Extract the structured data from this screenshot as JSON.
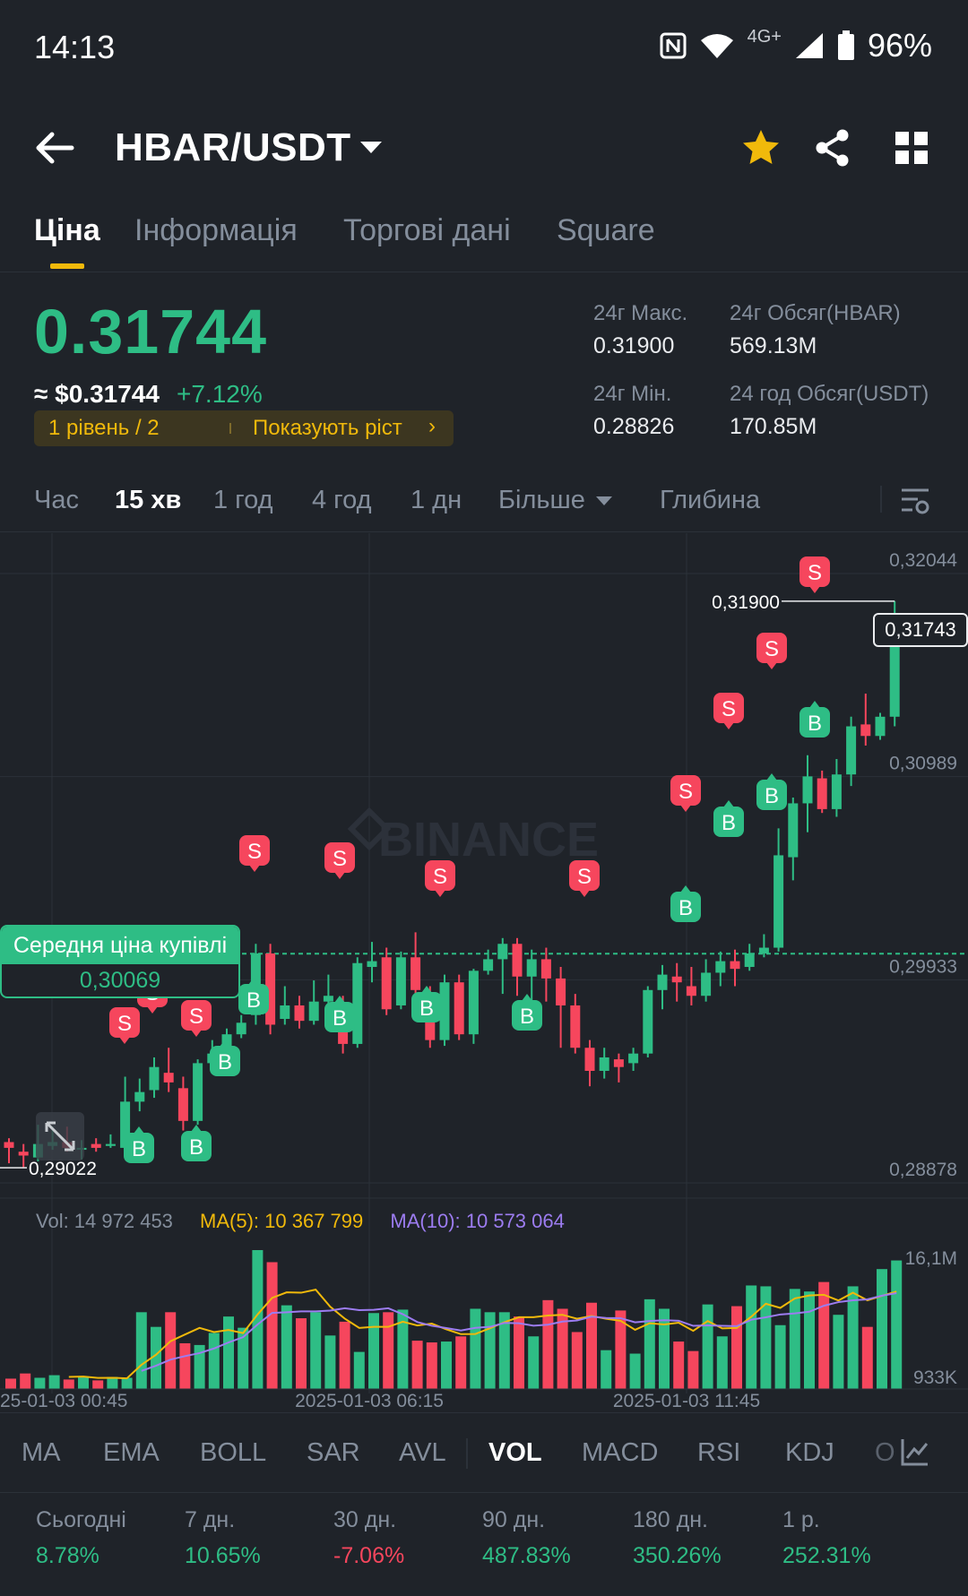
{
  "status": {
    "time": "14:13",
    "network": "4G+",
    "battery": "96%"
  },
  "header": {
    "pair": "HBAR/USDT"
  },
  "tabs": [
    {
      "label": "Ціна"
    },
    {
      "label": "Інформація"
    },
    {
      "label": "Торгові дані"
    },
    {
      "label": "Square"
    }
  ],
  "price": {
    "last": "0.31744",
    "usd": "≈ $0.31744",
    "change": "+7.12%",
    "level_left": "1 рівень / 2",
    "level_right": "Показують ріст"
  },
  "stats": {
    "high_label": "24г Макс.",
    "high": "0.31900",
    "vol_base_label": "24г Обсяг(HBAR)",
    "vol_base": "569.13M",
    "low_label": "24г Мін.",
    "low": "0.28826",
    "vol_quote_label": "24 год Обсяг(USDT)",
    "vol_quote": "170.85M"
  },
  "timeframes": {
    "time": "Час",
    "m15": "15 хв",
    "h1": "1 год",
    "h4": "4 год",
    "d1": "1 дн",
    "more": "Більше",
    "depth": "Глибина"
  },
  "chart_labels": {
    "axis": [
      "0,32044",
      "0,30989",
      "0,29933",
      "0,28878"
    ],
    "high_marker": "0,31900",
    "low_marker": "0,29022",
    "current": "0,31743",
    "avg_title": "Середня ціна купівлі",
    "avg_value": "0,30069",
    "watermark": "BINANCE",
    "vol_axis_top": "16,1M",
    "vol_axis_bottom": "933K",
    "dates": [
      "25-01-03 00:45",
      "2025-01-03 06:15",
      "2025-01-03 11:45"
    ],
    "sell": "S",
    "buy": "B"
  },
  "vol_info": {
    "vol": "Vol: 14 972 453",
    "ma5": "MA(5): 10 367 799",
    "ma10": "MA(10): 10 573 064"
  },
  "indicators": [
    "MA",
    "EMA",
    "BOLL",
    "SAR",
    "AVL",
    "VOL",
    "MACD",
    "RSI",
    "KDJ",
    "O"
  ],
  "performance": [
    {
      "label": "Сьогодні",
      "value": "8.78%"
    },
    {
      "label": "7 дн.",
      "value": "10.65%"
    },
    {
      "label": "30 дн.",
      "value": "-7.06%"
    },
    {
      "label": "90 дн.",
      "value": "487.83%"
    },
    {
      "label": "180 дн.",
      "value": "350.26%"
    },
    {
      "label": "1 р.",
      "value": "252.31%"
    }
  ],
  "colors": {
    "up": "#2ebd85",
    "down": "#f6465d",
    "accent": "#f0b90b",
    "ma5": "#f0b90b",
    "ma10": "#9c7cf0"
  },
  "chart_data": {
    "type": "candlestick",
    "interval": "15m",
    "y_axis_ticks": [
      0.32044,
      0.30989,
      0.29933,
      0.28878
    ],
    "high_24h": 0.319,
    "low_visible": 0.29022,
    "last": 0.31743,
    "avg_buy": 0.30069,
    "candles": [
      [
        0.2906,
        0.2909,
        0.2911,
        0.2898,
        "down"
      ],
      [
        0.2904,
        0.2902,
        0.2908,
        0.2896,
        "down"
      ],
      [
        0.2901,
        0.2908,
        0.2918,
        0.2899,
        "up"
      ],
      [
        0.2907,
        0.2909,
        0.2917,
        0.2905,
        "up"
      ],
      [
        0.2909,
        0.2906,
        0.2917,
        0.2904,
        "down"
      ],
      [
        0.2905,
        0.2906,
        0.291,
        0.29,
        "up"
      ],
      [
        0.2906,
        0.2908,
        0.2911,
        0.2904,
        "down"
      ],
      [
        0.2907,
        0.2908,
        0.2913,
        0.2906,
        "up"
      ],
      [
        0.2906,
        0.293,
        0.2943,
        0.2905,
        "up"
      ],
      [
        0.293,
        0.2935,
        0.2942,
        0.2925,
        "up"
      ],
      [
        0.2936,
        0.2948,
        0.2953,
        0.2932,
        "up"
      ],
      [
        0.2945,
        0.294,
        0.2958,
        0.2935,
        "down"
      ],
      [
        0.2937,
        0.292,
        0.2943,
        0.2915,
        "down"
      ],
      [
        0.292,
        0.295,
        0.2952,
        0.2918,
        "up"
      ],
      [
        0.295,
        0.2955,
        0.2962,
        0.2945,
        "up"
      ],
      [
        0.2955,
        0.2965,
        0.2968,
        0.2952,
        "up"
      ],
      [
        0.2965,
        0.2971,
        0.2975,
        0.2963,
        "up"
      ],
      [
        0.2975,
        0.3007,
        0.3012,
        0.297,
        "up"
      ],
      [
        0.3007,
        0.297,
        0.3012,
        0.2965,
        "down"
      ],
      [
        0.2973,
        0.298,
        0.299,
        0.297,
        "up"
      ],
      [
        0.298,
        0.2972,
        0.2985,
        0.2968,
        "down"
      ],
      [
        0.2972,
        0.2982,
        0.2993,
        0.297,
        "up"
      ],
      [
        0.2982,
        0.2985,
        0.2996,
        0.2978,
        "up"
      ],
      [
        0.298,
        0.296,
        0.2985,
        0.2955,
        "down"
      ],
      [
        0.296,
        0.3002,
        0.3005,
        0.2958,
        "up"
      ],
      [
        0.3,
        0.3003,
        0.3013,
        0.2992,
        "up"
      ],
      [
        0.3005,
        0.2978,
        0.301,
        0.2975,
        "down"
      ],
      [
        0.298,
        0.3005,
        0.3008,
        0.2978,
        "up"
      ],
      [
        0.3005,
        0.2988,
        0.3018,
        0.2985,
        "down"
      ],
      [
        0.2985,
        0.2962,
        0.299,
        0.2958,
        "down"
      ],
      [
        0.2962,
        0.2992,
        0.2996,
        0.2959,
        "up"
      ],
      [
        0.2992,
        0.2965,
        0.2996,
        0.2962,
        "down"
      ],
      [
        0.2965,
        0.2998,
        0.2999,
        0.296,
        "up"
      ],
      [
        0.2998,
        0.3004,
        0.3009,
        0.2996,
        "up"
      ],
      [
        0.3004,
        0.3012,
        0.3015,
        0.2986,
        "up"
      ],
      [
        0.3012,
        0.2995,
        0.3015,
        0.2985,
        "down"
      ],
      [
        0.2995,
        0.3004,
        0.3009,
        0.298,
        "up"
      ],
      [
        0.3004,
        0.2994,
        0.301,
        0.2982,
        "down"
      ],
      [
        0.2994,
        0.298,
        0.3,
        0.2958,
        "down"
      ],
      [
        0.298,
        0.2958,
        0.2986,
        0.2955,
        "down"
      ],
      [
        0.2958,
        0.2946,
        0.2962,
        0.2938,
        "down"
      ],
      [
        0.2946,
        0.2953,
        0.2958,
        0.2942,
        "up"
      ],
      [
        0.2952,
        0.2948,
        0.2955,
        0.294,
        "down"
      ],
      [
        0.295,
        0.2955,
        0.2958,
        0.2946,
        "up"
      ],
      [
        0.2955,
        0.2988,
        0.299,
        0.2953,
        "up"
      ],
      [
        0.2988,
        0.2996,
        0.3001,
        0.2978,
        "up"
      ],
      [
        0.2995,
        0.2992,
        0.3002,
        0.2982,
        "down"
      ],
      [
        0.299,
        0.2985,
        0.3,
        0.298,
        "down"
      ],
      [
        0.2985,
        0.2997,
        0.3004,
        0.2982,
        "up"
      ],
      [
        0.2997,
        0.3003,
        0.3008,
        0.299,
        "up"
      ],
      [
        0.3003,
        0.2999,
        0.3009,
        0.299,
        "down"
      ],
      [
        0.3,
        0.3007,
        0.3012,
        0.2998,
        "up"
      ],
      [
        0.3007,
        0.301,
        0.3017,
        0.3005,
        "up"
      ],
      [
        0.301,
        0.3058,
        0.3072,
        0.3008,
        "up"
      ],
      [
        0.3057,
        0.3085,
        0.3088,
        0.3045,
        "up"
      ],
      [
        0.3085,
        0.3099,
        0.311,
        0.307,
        "up"
      ],
      [
        0.3098,
        0.3082,
        0.3102,
        0.308,
        "down"
      ],
      [
        0.3082,
        0.31,
        0.3108,
        0.3078,
        "up"
      ],
      [
        0.31,
        0.3125,
        0.313,
        0.3094,
        "up"
      ],
      [
        0.3126,
        0.312,
        0.3142,
        0.3115,
        "down"
      ],
      [
        0.312,
        0.313,
        0.3132,
        0.3118,
        "up"
      ],
      [
        0.313,
        0.3174,
        0.319,
        0.3125,
        "up"
      ]
    ],
    "volume_millions": [
      1.2,
      1.8,
      1.3,
      1.6,
      1.1,
      1.4,
      1.0,
      1.4,
      1.3,
      8.9,
      7.2,
      8.9,
      5.3,
      5.1,
      6.5,
      8.4,
      7.1,
      16.1,
      14.7,
      9.7,
      8.2,
      8.9,
      6.2,
      7.8,
      4.3,
      8.8,
      8.9,
      9.2,
      5.6,
      5.4,
      5.5,
      6.1,
      9.3,
      8.9,
      8.9,
      8.4,
      6.1,
      10.3,
      9.3,
      6.6,
      10.0,
      4.5,
      9.1,
      4.1,
      10.4,
      9.3,
      5.5,
      4.4,
      9.8,
      6.1,
      9.6,
      12.0,
      11.9,
      7.4,
      11.6,
      11.3,
      12.4,
      8.6,
      11.9,
      7.2,
      13.9,
      14.9
    ],
    "volume_axis": [
      "16,1M",
      "933K"
    ],
    "x_labels": [
      "25-01-03 00:45",
      "2025-01-03 06:15",
      "2025-01-03 11:45"
    ]
  }
}
